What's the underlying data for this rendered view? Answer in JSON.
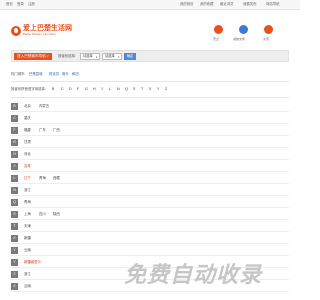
{
  "topbar": {
    "left_links": [
      "首页",
      "登录",
      "注册"
    ],
    "right_links": [
      "我的首页",
      "我的收藏",
      "最近浏览",
      "我要发布",
      "网站导航"
    ]
  },
  "header": {
    "logo_title": "爱上巴楚生活网",
    "logo_subtitle": "Bachu Xinxian · Life Gang",
    "icons": [
      {
        "name": "shield-icon",
        "label": "安全",
        "color": "#e8501c"
      },
      {
        "name": "handshake-icon",
        "label": "诚信交易",
        "color": "#3a7ad6"
      },
      {
        "name": "chat-icon",
        "label": "交流",
        "color": "#e8501c"
      }
    ]
  },
  "search": {
    "city_button": "进入巴楚城市导航 >",
    "select_label": "按省份选择:",
    "province_value": "请选择",
    "city_value": "请选择",
    "go_button": "确定"
  },
  "hot": {
    "label": "热门城市:",
    "cities": [
      "巴楚县城",
      "阿克苏",
      "喀什",
      "和田"
    ]
  },
  "alphabet": {
    "label": "按省份拼音首字母选择:",
    "letters": [
      "B",
      "C",
      "D",
      "F",
      "G",
      "H",
      "J",
      "L",
      "N",
      "Q",
      "S",
      "T",
      "X",
      "Y",
      "Z"
    ]
  },
  "provinces": [
    {
      "letter": "B",
      "names": [
        "北京",
        "内蒙古"
      ],
      "highlight": [
        false,
        false
      ]
    },
    {
      "letter": "C",
      "names": [
        "重庆"
      ],
      "highlight": [
        false
      ]
    },
    {
      "letter": "F",
      "names": [
        "福建",
        "广东",
        "广西"
      ],
      "highlight": [
        false,
        false,
        false
      ]
    },
    {
      "letter": "G",
      "names": [
        "甘肃"
      ],
      "highlight": [
        false
      ]
    },
    {
      "letter": "H",
      "names": [
        "河北"
      ],
      "highlight": [
        false
      ]
    },
    {
      "letter": "J",
      "names": [
        "吉林"
      ],
      "highlight": [
        true
      ]
    },
    {
      "letter": "L",
      "names": [
        "辽宁",
        "青海",
        "西藏"
      ],
      "highlight": [
        true,
        false,
        false
      ]
    },
    {
      "letter": "N",
      "names": [
        "浙江"
      ],
      "highlight": [
        false
      ]
    },
    {
      "letter": "Q",
      "names": [
        "青海"
      ],
      "highlight": [
        false
      ]
    },
    {
      "letter": "S",
      "names": [
        "上海",
        "四川",
        "陕西"
      ],
      "highlight": [
        false,
        false,
        false
      ]
    },
    {
      "letter": "T",
      "names": [
        "天津"
      ],
      "highlight": [
        false
      ]
    },
    {
      "letter": "X",
      "names": [
        "新疆"
      ],
      "highlight": [
        false
      ]
    },
    {
      "letter": "Y",
      "names": [
        "云南"
      ],
      "highlight": [
        false
      ]
    },
    {
      "letter": "Y",
      "names": [
        "新疆维吾尔"
      ],
      "highlight": [
        true
      ]
    },
    {
      "letter": "Z",
      "names": [
        "浙江"
      ],
      "highlight": [
        false
      ]
    },
    {
      "letter": "Z",
      "names": [
        "云南"
      ],
      "highlight": [
        false
      ]
    }
  ],
  "watermark": "免费自动收录"
}
